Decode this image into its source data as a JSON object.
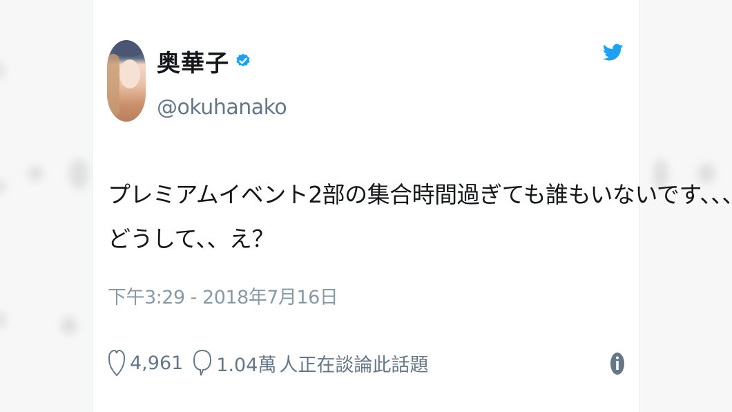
{
  "tweet": {
    "display_name": "奥華子",
    "handle": "@okuhanako",
    "text_lines": [
      "プレミアムイベント2部の集合時間過ぎても誰もいないです、、、",
      "どうして、、え？"
    ],
    "timestamp": "下午3:29 - 2018年7月16日",
    "likes": "4,961",
    "replies": "1.04萬",
    "talking_label": "人正在談論此話題"
  },
  "icons": {
    "verified": "verified-badge-icon",
    "brand": "twitter-bird-icon",
    "like": "heart-icon",
    "reply": "speech-bubble-icon",
    "info": "info-icon"
  },
  "colors": {
    "text": "#14171a",
    "secondary": "#657786",
    "timestamp": "#8899a6",
    "twitter_blue": "#1da1f2"
  }
}
